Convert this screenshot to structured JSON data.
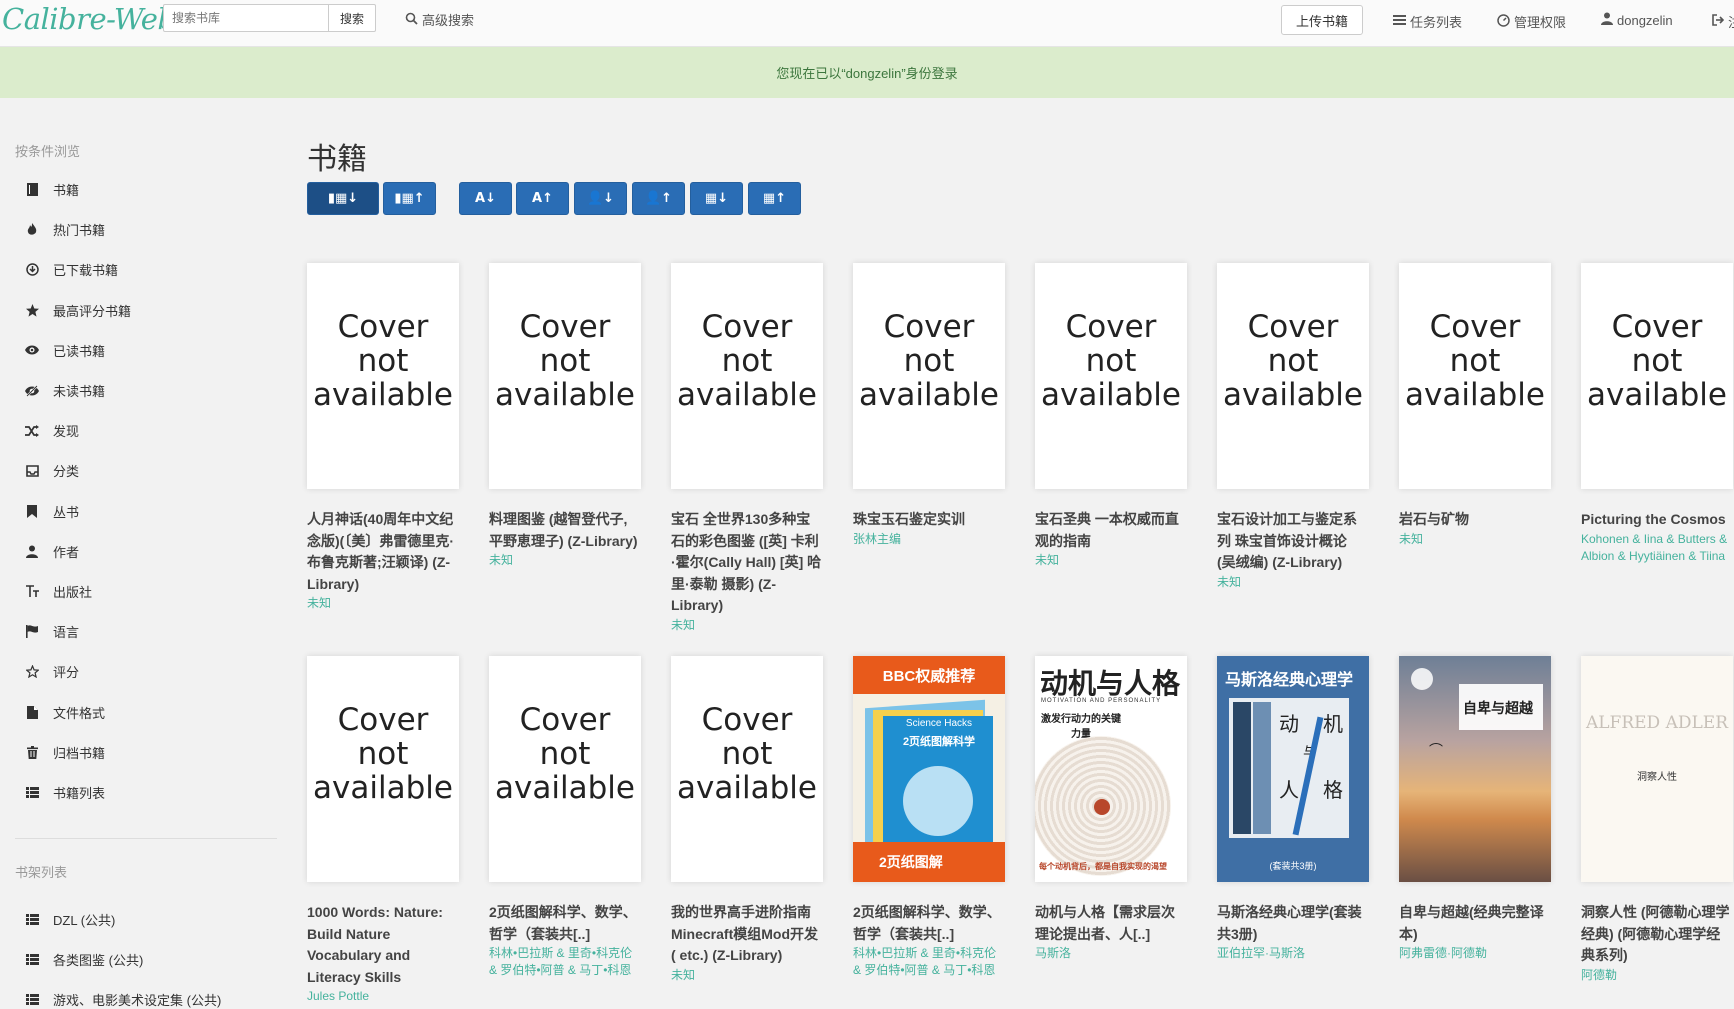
{
  "brand": "Calibre-Web",
  "search": {
    "placeholder": "搜索书库",
    "button": "搜索"
  },
  "nav": {
    "advanced_search": "高级搜索",
    "upload": "上传书籍",
    "tasks": "任务列表",
    "admin": "管理权限",
    "user": "dongzelin",
    "logout": "注"
  },
  "flash": "您现在已以“dongzelin”身份登录",
  "sidebar": {
    "browse_heading": "按条件浏览",
    "items": [
      {
        "label": "书籍",
        "icon": "book-icon"
      },
      {
        "label": "热门书籍",
        "icon": "fire-icon"
      },
      {
        "label": "已下载书籍",
        "icon": "download-icon"
      },
      {
        "label": "最高评分书籍",
        "icon": "star-icon"
      },
      {
        "label": "已读书籍",
        "icon": "eye-icon"
      },
      {
        "label": "未读书籍",
        "icon": "eye-slash-icon"
      },
      {
        "label": "发现",
        "icon": "random-icon"
      },
      {
        "label": "分类",
        "icon": "inbox-icon"
      },
      {
        "label": "丛书",
        "icon": "bookmark-icon"
      },
      {
        "label": "作者",
        "icon": "user-icon"
      },
      {
        "label": "出版社",
        "icon": "text-size-icon"
      },
      {
        "label": "语言",
        "icon": "flag-icon"
      },
      {
        "label": "评分",
        "icon": "star-empty-icon"
      },
      {
        "label": "文件格式",
        "icon": "file-icon"
      },
      {
        "label": "归档书籍",
        "icon": "trash-icon"
      },
      {
        "label": "书籍列表",
        "icon": "list-icon"
      }
    ],
    "shelves_heading": "书架列表",
    "shelves": [
      {
        "label": "DZL (公共)",
        "icon": "list-icon"
      },
      {
        "label": "各类图鉴 (公共)",
        "icon": "list-icon"
      },
      {
        "label": "游戏、电影美术设定集 (公共)",
        "icon": "list-icon"
      }
    ]
  },
  "main": {
    "title": "书籍",
    "sort_buttons": [
      {
        "label": "▮▦↓",
        "icon": "sort-newest-icon"
      },
      {
        "label": "▮▦↑",
        "icon": "sort-oldest-icon"
      },
      {
        "label": "A↓",
        "icon": "sort-title-asc-icon"
      },
      {
        "label": "A↑",
        "icon": "sort-title-desc-icon"
      },
      {
        "label": "👤↓",
        "icon": "sort-author-asc-icon"
      },
      {
        "label": "👤↑",
        "icon": "sort-author-desc-icon"
      },
      {
        "label": "▦↓",
        "icon": "sort-pubdate-new-icon"
      },
      {
        "label": "▦↑",
        "icon": "sort-pubdate-old-icon"
      }
    ],
    "cover_placeholder": "Cover\nnot\navailable",
    "books": [
      {
        "title": "人月神话(40周年中文纪念版)(〔美〕弗雷德里克·布鲁克斯著;汪颖译) (Z-Library)",
        "author": "未知"
      },
      {
        "title": "料理图鉴 (越智登代子, 平野恵理子) (Z-Library)",
        "author": "未知"
      },
      {
        "title": "宝石 全世界130多种宝石的彩色图鉴 ([英] 卡利·霍尔(Cally Hall) [英] 哈里·泰勒 摄影) (Z-Library)",
        "author": "未知"
      },
      {
        "title": "珠宝玉石鉴定实训",
        "author": "张林主编"
      },
      {
        "title": "宝石圣典 一本权威而直观的指南",
        "author": "未知"
      },
      {
        "title": "宝石设计加工与鉴定系列 珠宝首饰设计概论 (吴绒编) (Z-Library)",
        "author": "未知"
      },
      {
        "title": "岩石与矿物",
        "author": "未知"
      },
      {
        "title": "Picturing the Cosmos",
        "author": "Kohonen & Iina & Butters & Albion & Hyytiäinen & Tiina"
      },
      {
        "title": "1000 Words: Nature: Build Nature Vocabulary and Literacy Skills",
        "author": "Jules Pottle"
      },
      {
        "title": "2页纸图解科学、数学、哲学（套装共[..]",
        "author": "科林•巴拉斯 & 里奇•科克伦 & 罗伯特•阿普 & 马丁•科恩"
      },
      {
        "title": "我的世界高手进阶指南Minecraft模组Mod开发 ( etc.) (Z-Library)",
        "author": "未知"
      },
      {
        "title": "2页纸图解科学、数学、哲学（套装共[..]",
        "author": "科林•巴拉斯 & 里奇•科克伦 & 罗伯特•阿普 & 马丁•科恩"
      },
      {
        "title": "动机与人格【需求层次理论提出者、人[..]",
        "author": "马斯洛"
      },
      {
        "title": "马斯洛经典心理学(套装共3册)",
        "author": "亚伯拉罕·马斯洛"
      },
      {
        "title": "自卑与超越(经典完整译本)",
        "author": "阿弗雷德·阿德勒"
      },
      {
        "title": "洞察人性 (阿德勒心理学经典) (阿德勒心理学经典系列)",
        "author": "阿德勒"
      }
    ],
    "cover_art": {
      "bbc": {
        "banner": "BBC权威推荐",
        "sub": "Science Hacks",
        "title": "2页纸图解科学",
        "footer": "2页纸图解",
        "bar_color": "#1f8fd0",
        "accent": "#e85a1b"
      },
      "motivation": {
        "title": "动机与人格",
        "en": "MOTIVATION AND PERSONALITY",
        "sub": "激发行动力的关键力量",
        "footer": "每个动机背后，都是自我实现的渴望"
      },
      "maslow": {
        "title": "马斯洛经典心理学",
        "c1": "动",
        "c2": "机",
        "c3": "与",
        "c4": "人",
        "c5": "格",
        "footer": "(套装共3册)"
      },
      "adler1": {
        "title": "自卑与超越"
      },
      "adler2": {
        "en": "ALFRED ADLER",
        "title": "洞察人性"
      }
    }
  }
}
